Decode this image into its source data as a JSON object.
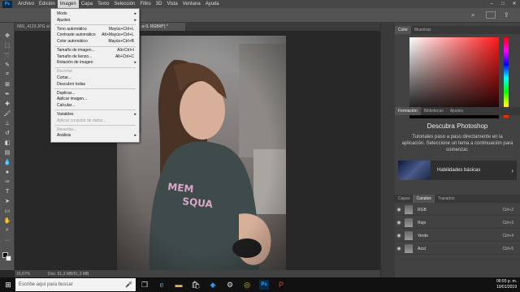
{
  "menubar": {
    "items": [
      "Archivo",
      "Edición",
      "Imagen",
      "Capa",
      "Texto",
      "Selección",
      "Filtro",
      "3D",
      "Vista",
      "Ventana",
      "Ayuda"
    ],
    "active_index": 2
  },
  "tabs": [
    {
      "label": "IMG_4123.JPG al 2..."
    },
    {
      "label": "...e 0, RGB/8*) *"
    }
  ],
  "image_menu": {
    "items": [
      {
        "label": "Modo",
        "shortcut": "",
        "submenu": true,
        "disabled": false
      },
      {
        "label": "Ajustes",
        "shortcut": "",
        "submenu": true,
        "disabled": false
      },
      {
        "label": "Tono automático",
        "shortcut": "Mayús+Ctrl+L",
        "submenu": false,
        "disabled": false
      },
      {
        "label": "Contraste automático",
        "shortcut": "Alt+Mayús+Ctrl+L",
        "submenu": false,
        "disabled": false
      },
      {
        "label": "Color automático",
        "shortcut": "Mayús+Ctrl+B",
        "submenu": false,
        "disabled": false
      },
      {
        "label": "Tamaño de imagen...",
        "shortcut": "Alt+Ctrl+I",
        "submenu": false,
        "disabled": false
      },
      {
        "label": "Tamaño de lienzo...",
        "shortcut": "Alt+Ctrl+C",
        "submenu": false,
        "disabled": false
      },
      {
        "label": "Rotación de imagen",
        "shortcut": "",
        "submenu": true,
        "disabled": false
      },
      {
        "label": "Recortar",
        "shortcut": "",
        "submenu": false,
        "disabled": true
      },
      {
        "label": "Cortar...",
        "shortcut": "",
        "submenu": false,
        "disabled": false
      },
      {
        "label": "Descubrir todas",
        "shortcut": "",
        "submenu": false,
        "disabled": false
      },
      {
        "label": "Duplicar...",
        "shortcut": "",
        "submenu": false,
        "disabled": false
      },
      {
        "label": "Aplicar imagen...",
        "shortcut": "",
        "submenu": false,
        "disabled": false
      },
      {
        "label": "Calcular...",
        "shortcut": "",
        "submenu": false,
        "disabled": false
      },
      {
        "label": "Variables",
        "shortcut": "",
        "submenu": true,
        "disabled": false
      },
      {
        "label": "Aplicar conjunto de datos...",
        "shortcut": "",
        "submenu": false,
        "disabled": true
      },
      {
        "label": "Reventar...",
        "shortcut": "",
        "submenu": false,
        "disabled": true
      },
      {
        "label": "Análisis",
        "shortcut": "",
        "submenu": true,
        "disabled": false
      }
    ]
  },
  "status": {
    "zoom": "16,67%",
    "doc": "Doc: 51,3 MB/51,3 MB"
  },
  "panels": {
    "color_tabs": [
      "Color",
      "Muestras"
    ],
    "learn_tabs": [
      "Formación",
      "Bibliotecas",
      "Ajustes"
    ],
    "learn_title": "Descubra Photoshop",
    "learn_desc": "Tutoriales paso a paso directamente en la aplicación. Seleccione un tema a continuación para comenzar.",
    "learn_card": "Habilidades básicas",
    "layer_tabs": [
      "Capas",
      "Canales",
      "Trazados"
    ],
    "channels": [
      {
        "name": "RGB",
        "shortcut": "Ctrl+2"
      },
      {
        "name": "Rojo",
        "shortcut": "Ctrl+3"
      },
      {
        "name": "Verde",
        "shortcut": "Ctrl+4"
      },
      {
        "name": "Azul",
        "shortcut": "Ctrl+5"
      }
    ]
  },
  "colors": {
    "foreground": "#000000",
    "background": "#ffffff",
    "picker_hue": "#ff1a1a"
  },
  "taskbar": {
    "search_placeholder": "Escribe aquí para buscar",
    "clock_time": "06:55 p. m.",
    "clock_date": "10/01/2019",
    "icons": [
      "task-view-icon",
      "edge-icon",
      "file-explorer-icon",
      "store-icon",
      "dropbox-icon",
      "settings-icon",
      "chrome-icon",
      "photoshop-icon",
      "powerpoint-icon"
    ]
  }
}
